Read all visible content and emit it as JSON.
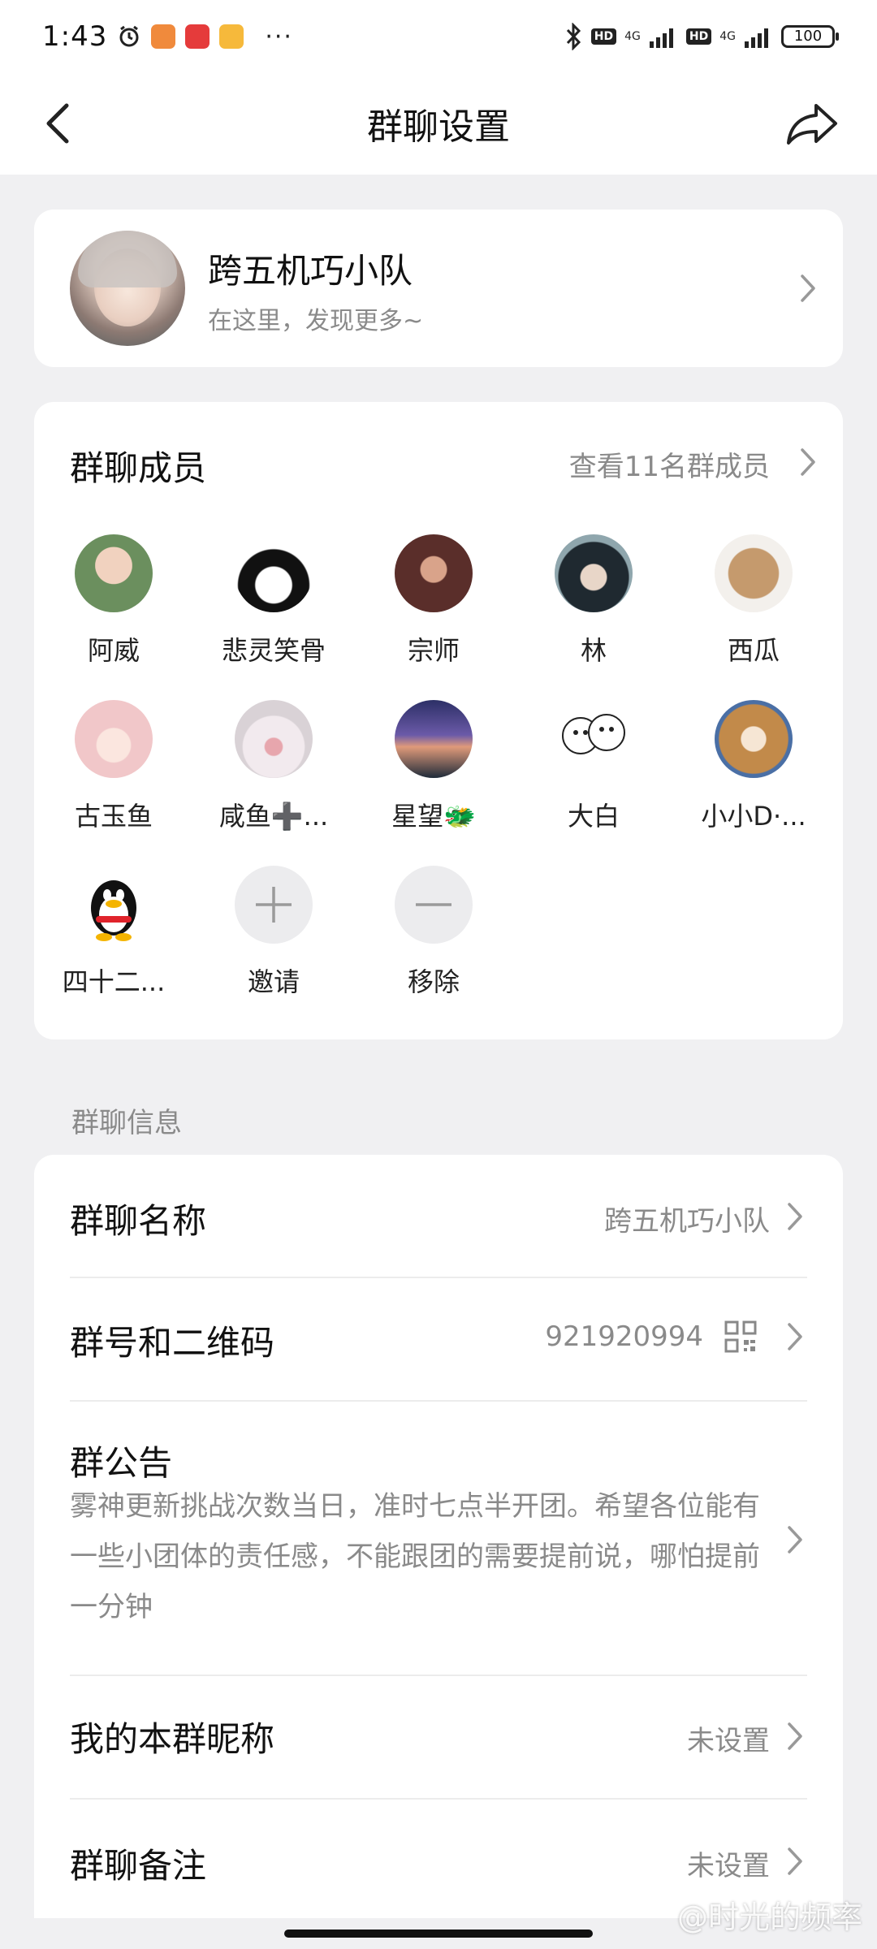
{
  "status_bar": {
    "time": "1:43",
    "network_left": "4G",
    "network_right": "4G",
    "hd_left": "HD",
    "hd_right": "HD",
    "battery": "100",
    "more": "···"
  },
  "nav": {
    "title": "群聊设置"
  },
  "group": {
    "name": "跨五机巧小队",
    "subtitle": "在这里，发现更多~"
  },
  "members": {
    "title": "群聊成员",
    "view_all": "查看11名群成员",
    "list": [
      {
        "name": "阿威",
        "color": "#6b8f5e"
      },
      {
        "name": "悲灵笑骨",
        "color": "#ffffff"
      },
      {
        "name": "宗师",
        "color": "#5a2e2a"
      },
      {
        "name": "林",
        "color": "#3b4b53"
      },
      {
        "name": "西瓜",
        "color": "#c59a6d"
      },
      {
        "name": "古玉鱼",
        "color": "#f1c7c9"
      },
      {
        "name": "咸鱼➕...",
        "color": "#e7dfe3"
      },
      {
        "name": "星望🐲",
        "color": "#3b3f7a"
      },
      {
        "name": "大白",
        "color": "#ffffff"
      },
      {
        "name": "小小D·...",
        "color": "#c28a4a"
      },
      {
        "name": "四十二...",
        "color": "#ffffff"
      }
    ],
    "invite_label": "邀请",
    "remove_label": "移除"
  },
  "info": {
    "section_label": "群聊信息",
    "name_row": {
      "title": "群聊名称",
      "value": "跨五机巧小队"
    },
    "number_row": {
      "title": "群号和二维码",
      "value": "921920994"
    },
    "announcement": {
      "title": "群公告",
      "text": "雾神更新挑战次数当日，准时七点半开团。希望各位能有一些小团体的责任感，不能跟团的需要提前说，哪怕提前一分钟"
    },
    "nickname_row": {
      "title": "我的本群昵称",
      "value": "未设置"
    },
    "remark_row": {
      "title": "群聊备注",
      "value": "未设置"
    }
  },
  "watermark": "@时光的频率",
  "colors": {
    "background": "#f0f0f2",
    "card": "#ffffff",
    "secondary_text": "#8a8a8a"
  }
}
